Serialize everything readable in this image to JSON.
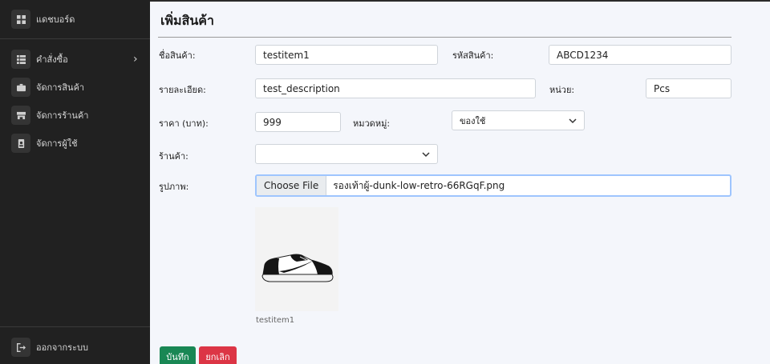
{
  "sidebar": {
    "items": [
      {
        "label": "แดชบอร์ด",
        "icon": "dashboard-icon"
      },
      {
        "label": "คำสั่งซื้อ",
        "icon": "list-icon",
        "chevron": "›"
      },
      {
        "label": "จัดการสินค้า",
        "icon": "briefcase-icon"
      },
      {
        "label": "จัดการร้านค้า",
        "icon": "store-icon"
      },
      {
        "label": "จัดการผู้ใช้",
        "icon": "user-badge-icon"
      }
    ],
    "logout": {
      "label": "ออกจากระบบ",
      "icon": "logout-icon"
    }
  },
  "form": {
    "title": "เพิ่มสินค้า",
    "name_label": "ชื่อสินค้า:",
    "name_value": "testitem1",
    "code_label": "รหัสสินค้า:",
    "code_value": "ABCD1234",
    "desc_label": "รายละเอียด:",
    "desc_value": "test_description",
    "unit_label": "หน่วย:",
    "unit_value": "Pcs",
    "price_label": "ราคา (บาท):",
    "price_value": "999",
    "category_label": "หมวดหมู่:",
    "category_value": "ของใช้",
    "store_label": "ร้านค้า:",
    "store_value": "",
    "image_label": "รูปภาพ:",
    "file_button": "Choose File",
    "file_name": "รองเท้าผู้-dunk-low-retro-66RGqF.png",
    "preview_caption": "testitem1",
    "save_label": "บันทึก",
    "cancel_label": "ยกเลิก"
  },
  "colors": {
    "sidebar_bg": "#212121",
    "save": "#198754",
    "cancel": "#dc3545",
    "focus_border": "#9ec5fe"
  }
}
